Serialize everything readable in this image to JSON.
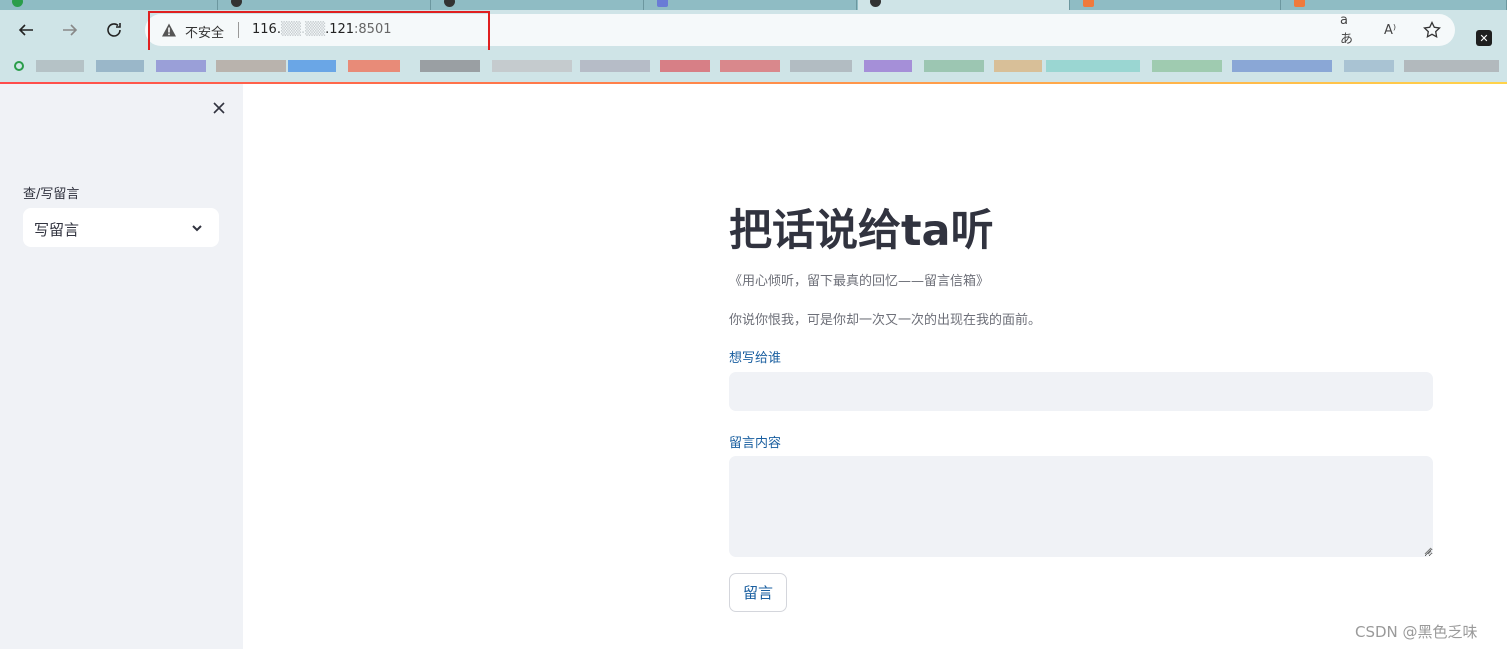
{
  "browser": {
    "security_label": "不安全",
    "url_host": "116.",
    "url_masked": "▒▒.▒▒",
    "url_suffix": ".121",
    "url_port": ":8501",
    "read_aloud_icon": "A⁾",
    "translate_icon": "aあ"
  },
  "sidebar": {
    "label": "查/写留言",
    "select_value": "写留言"
  },
  "main": {
    "title": "把话说给ta听",
    "subtitle": "《用心倾听，留下最真的回忆——留言信箱》",
    "paragraph": "你说你恨我，可是你却一次又一次的出现在我的面前。",
    "recipient_label": "想写给谁",
    "message_label": "留言内容",
    "submit_label": "留言"
  },
  "watermark": "CSDN @黑色乏味",
  "colors": {
    "accent": "#ff4b4b",
    "label_blue": "#1a5fa0",
    "sidebar_bg": "#f0f2f6",
    "highlight_red": "#e02020"
  }
}
